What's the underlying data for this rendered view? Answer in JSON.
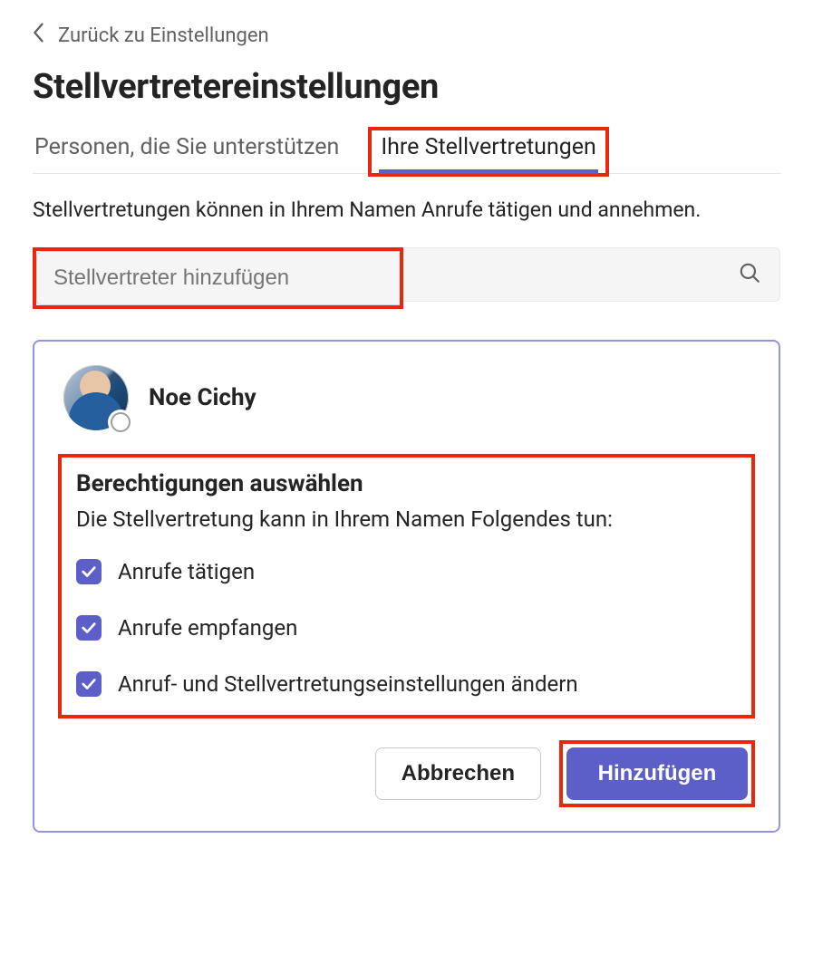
{
  "back": {
    "label": "Zurück zu Einstellungen"
  },
  "title": "Stellvertretereinstellungen",
  "tabs": {
    "support": "Personen, die Sie unterstützen",
    "delegates": "Ihre Stellvertretungen"
  },
  "description": "Stellvertretungen können in Ihrem Namen Anrufe tätigen und annehmen.",
  "search": {
    "placeholder": "Stellvertreter hinzufügen"
  },
  "card": {
    "person_name": "Noe Cichy",
    "permissions_title": "Berechtigungen auswählen",
    "permissions_desc": "Die Stellvertretung kann in Ihrem Namen Folgendes tun:",
    "permissions": [
      {
        "label": "Anrufe tätigen",
        "checked": true
      },
      {
        "label": "Anrufe empfangen",
        "checked": true
      },
      {
        "label": "Anruf- und Stellvertretungseinstellungen ändern",
        "checked": true
      }
    ],
    "cancel": "Abbrechen",
    "add": "Hinzufügen"
  },
  "colors": {
    "accent": "#5b5fc7",
    "highlight": "#E8270F"
  }
}
